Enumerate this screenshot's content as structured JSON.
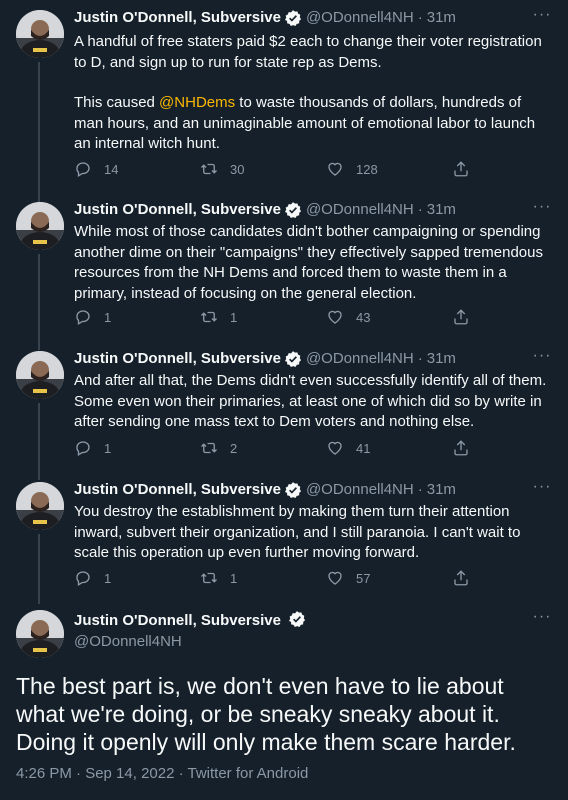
{
  "author": {
    "name": "Justin O'Donnell, Subversive",
    "handle": "@ODonnell4NH"
  },
  "colors": {
    "background": "#15202b",
    "text": "#f7f9f9",
    "muted": "#8b98a5",
    "mention": "#fcb800"
  },
  "tweets": [
    {
      "time": "31m",
      "text_1": "A handful of free staters paid $2 each to change their voter registration to D, and sign up to run for state rep as Dems.",
      "text_2a": "This caused ",
      "mention": "@NHDems",
      "text_2b": " to waste thousands of dollars, hundreds of man hours, and an unimaginable amount of emotional labor to launch an internal witch hunt.",
      "replies": "14",
      "retweets": "30",
      "likes": "128"
    },
    {
      "time": "31m",
      "text": "While most of those candidates didn't bother campaigning or spending another dime on their \"campaigns\" they effectively sapped tremendous resources from the NH Dems and forced them to waste them in a primary, instead of focusing on the general election.",
      "replies": "1",
      "retweets": "1",
      "likes": "43"
    },
    {
      "time": "31m",
      "text": "And after all that, the Dems didn't even successfully identify all of them. Some even won their primaries, at least one of which did so by write in after sending one mass text to Dem voters and nothing else.",
      "replies": "1",
      "retweets": "2",
      "likes": "41"
    },
    {
      "time": "31m",
      "text": "You destroy the establishment by making them turn their attention inward, subvert their organization, and I still paranoia. I can't wait to scale this operation up even further moving forward.",
      "replies": "1",
      "retweets": "1",
      "likes": "57"
    }
  ],
  "main_tweet": {
    "text": "The best part is, we don't even have to lie about what we're doing, or be sneaky sneaky about it. Doing it openly will only make them scare harder.",
    "meta": "4:26 PM · Sep 14, 2022 · Twitter for Android"
  },
  "separator": "·",
  "icons": [
    "reply-icon",
    "retweet-icon",
    "like-icon",
    "share-icon",
    "verified-icon",
    "more-icon"
  ]
}
